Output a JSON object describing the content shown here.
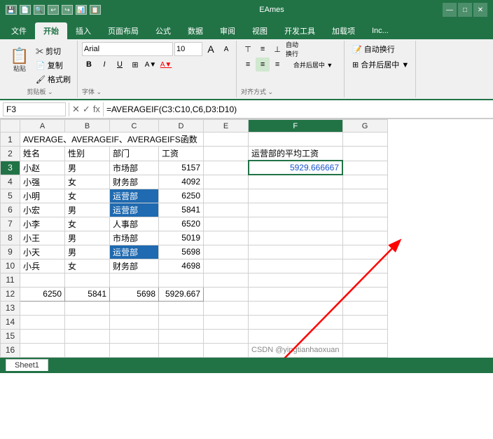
{
  "titleBar": {
    "icons": [
      "💾",
      "📄",
      "🔍",
      "↩",
      "↪",
      "📊",
      "📋"
    ],
    "title": "EAmes",
    "winControls": [
      "—",
      "□",
      "✕"
    ]
  },
  "ribbonTabs": [
    "文件",
    "开始",
    "插入",
    "页面布局",
    "公式",
    "数据",
    "审阅",
    "视图",
    "开发工具",
    "加载项",
    "Inc..."
  ],
  "activeTab": "开始",
  "clipboard": {
    "label": "剪贴板",
    "buttons": [
      "剪切",
      "复制",
      "格式刷",
      "粘贴"
    ]
  },
  "font": {
    "label": "字体",
    "name": "Arial",
    "size": "10",
    "bold": "B",
    "italic": "I",
    "underline": "U"
  },
  "alignment": {
    "label": "对齐方式",
    "mergeLabel": "合并后居中"
  },
  "formulaBar": {
    "cellRef": "F3",
    "formula": "=AVERAGEIF(C3:C10,C6,D3:D10)"
  },
  "columns": [
    "A",
    "B",
    "C",
    "D",
    "E",
    "F",
    "G"
  ],
  "rows": [
    {
      "id": 1,
      "cells": [
        "AVERAGE、AVERAGEIF、AVERAGEIFS函数",
        "",
        "",
        "",
        "",
        "",
        ""
      ]
    },
    {
      "id": 2,
      "cells": [
        "姓名",
        "性别",
        "部门",
        "工资",
        "",
        "运营部的平均工资",
        ""
      ]
    },
    {
      "id": 3,
      "cells": [
        "小赵",
        "男",
        "市场部",
        "5157",
        "",
        "5929.666667",
        ""
      ]
    },
    {
      "id": 4,
      "cells": [
        "小强",
        "女",
        "财务部",
        "4092",
        "",
        "",
        ""
      ]
    },
    {
      "id": 5,
      "cells": [
        "小明",
        "女",
        "运营部",
        "6250",
        "",
        "",
        ""
      ]
    },
    {
      "id": 6,
      "cells": [
        "小宏",
        "男",
        "运营部",
        "5841",
        "",
        "",
        ""
      ]
    },
    {
      "id": 7,
      "cells": [
        "小李",
        "女",
        "人事部",
        "6520",
        "",
        "",
        ""
      ]
    },
    {
      "id": 8,
      "cells": [
        "小王",
        "男",
        "市场部",
        "5019",
        "",
        "",
        ""
      ]
    },
    {
      "id": 9,
      "cells": [
        "小天",
        "男",
        "运营部",
        "5698",
        "",
        "",
        ""
      ]
    },
    {
      "id": 10,
      "cells": [
        "小兵",
        "女",
        "财务部",
        "4698",
        "",
        "",
        ""
      ]
    },
    {
      "id": 11,
      "cells": [
        "",
        "",
        "",
        "",
        "",
        "",
        ""
      ]
    },
    {
      "id": 12,
      "cells": [
        "6250",
        "5841",
        "5698",
        "5929.667",
        "",
        "",
        ""
      ]
    },
    {
      "id": 13,
      "cells": [
        "",
        "",
        "",
        "",
        "",
        "",
        ""
      ]
    },
    {
      "id": 14,
      "cells": [
        "",
        "",
        "",
        "",
        "",
        "",
        ""
      ]
    },
    {
      "id": 15,
      "cells": [
        "",
        "",
        "",
        "",
        "",
        "",
        ""
      ]
    },
    {
      "id": 16,
      "cells": [
        "",
        "",
        "",
        "",
        "",
        "",
        ""
      ]
    }
  ],
  "watermark": "CSDN @yingtianhaoxuan",
  "bottomBar": {
    "sheetTab": "Sheet1"
  }
}
